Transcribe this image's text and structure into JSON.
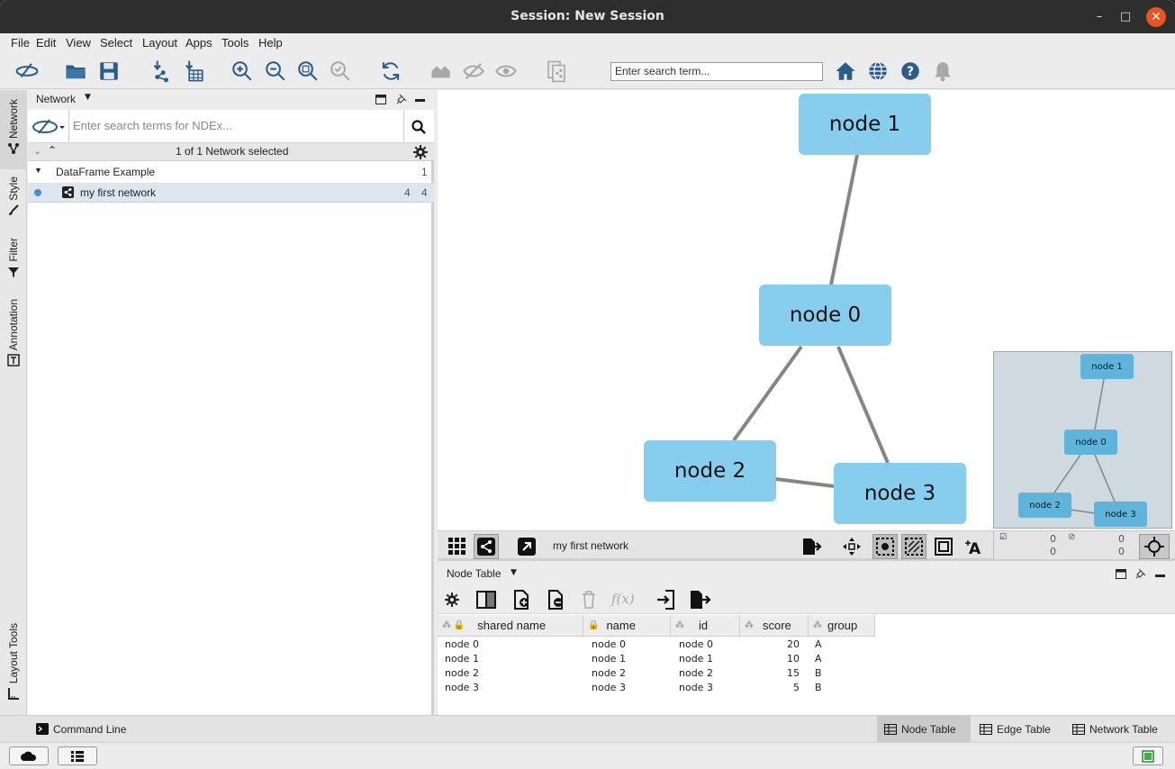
{
  "window": {
    "title": "Session: New Session",
    "minimize": "–",
    "maximize": "□",
    "close": "✕"
  },
  "menu": [
    "File",
    "Edit",
    "View",
    "Select",
    "Layout",
    "Apps",
    "Tools",
    "Help"
  ],
  "toolbar": {
    "search_placeholder": "Enter search term..."
  },
  "sidetabs": [
    "Network",
    "Style",
    "Filter",
    "Annotation",
    "Layout Tools"
  ],
  "network_panel": {
    "title": "Network",
    "ndex_placeholder": "Enter search terms for NDEx...",
    "selection_text": "1 of 1 Network selected",
    "collection": {
      "name": "DataFrame Example",
      "count": "1"
    },
    "network": {
      "name": "my first network",
      "nodes": "4",
      "edges": "4"
    }
  },
  "graph": {
    "nodes": [
      "node 1",
      "node 0",
      "node 2",
      "node 3"
    ]
  },
  "minimap": {
    "nodes": [
      "node 1",
      "node 0",
      "node 2",
      "node 3"
    ]
  },
  "network_bar": {
    "name": "my first network",
    "sel_nodes": "0",
    "sel_edges": "0",
    "hidden_nodes": "0",
    "hidden_edges": "0"
  },
  "table_panel": {
    "title": "Node Table",
    "columns": [
      "shared name",
      "name",
      "id",
      "score",
      "group"
    ],
    "rows": [
      [
        "node 0",
        "node 0",
        "node 0",
        "20",
        "A"
      ],
      [
        "node 1",
        "node 1",
        "node 1",
        "10",
        "A"
      ],
      [
        "node 2",
        "node 2",
        "node 2",
        "15",
        "B"
      ],
      [
        "node 3",
        "node 3",
        "node 3",
        "5",
        "B"
      ]
    ]
  },
  "bottom": {
    "command_line": "Command Line",
    "tabs": [
      "Node Table",
      "Edge Table",
      "Network Table"
    ]
  },
  "colors": {
    "node_fill": "#86cdee",
    "titlebar": "#2e2e2e",
    "close": "#e95420"
  }
}
